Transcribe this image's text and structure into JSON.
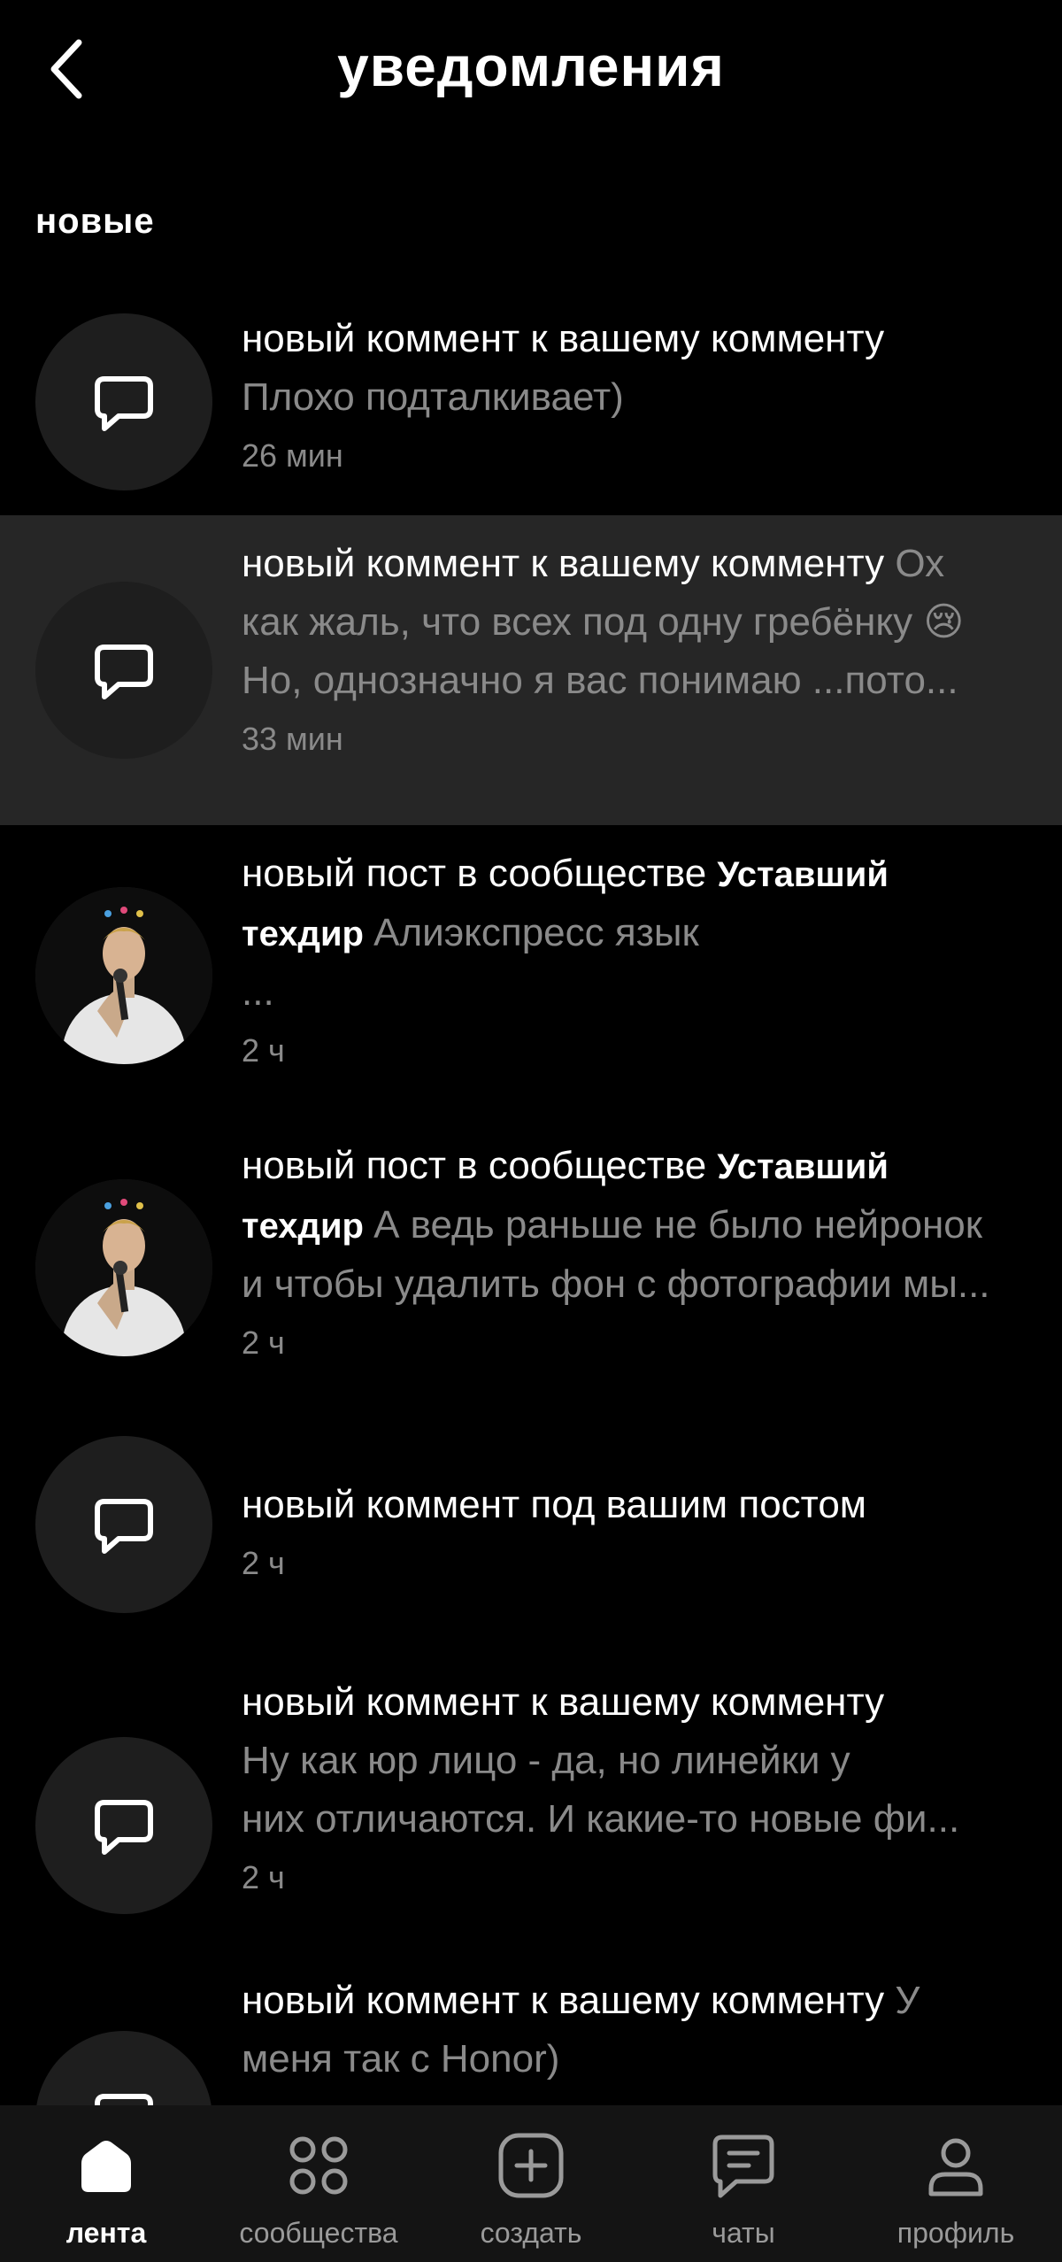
{
  "header": {
    "title": "уведомления"
  },
  "section": {
    "label": "новые"
  },
  "notifications": [
    {
      "lines": [
        [
          {
            "t": "новый коммент к вашему комменту",
            "c": "w"
          }
        ],
        [
          {
            "t": "Плохо подталкивает)",
            "c": "g"
          }
        ]
      ],
      "time": "26 мин",
      "icon": "comment-icon"
    },
    {
      "lines": [
        [
          {
            "t": "новый коммент к вашему комменту ",
            "c": "w"
          },
          {
            "t": "Ох",
            "c": "g"
          }
        ],
        [
          {
            "t": "как жаль, что всех под одну гребёнку 😢",
            "c": "g"
          }
        ],
        [
          {
            "t": "Но,  однозначно я вас понимаю ...пото...",
            "c": "g"
          }
        ]
      ],
      "time": "33 мин",
      "icon": "comment-icon"
    },
    {
      "lines": [
        [
          {
            "t": "новый пост в сообществе ",
            "c": "w"
          },
          {
            "t": "Уставший",
            "c": "b"
          }
        ],
        [
          {
            "t": "техдир ",
            "c": "b"
          },
          {
            "t": "Алиэкспресс язык",
            "c": "g"
          }
        ],
        [
          {
            "t": "...",
            "c": "g"
          }
        ]
      ],
      "time": "2 ч",
      "icon": "community-avatar"
    },
    {
      "lines": [
        [
          {
            "t": "новый пост в сообществе ",
            "c": "w"
          },
          {
            "t": "Уставший",
            "c": "b"
          }
        ],
        [
          {
            "t": "техдир ",
            "c": "b"
          },
          {
            "t": "А ведь раньше не было нейронок",
            "c": "g"
          }
        ],
        [
          {
            "t": "и чтобы удалить фон с фотографии мы...",
            "c": "g"
          }
        ]
      ],
      "time": "2 ч",
      "icon": "community-avatar"
    },
    {
      "lines": [
        [
          {
            "t": "новый коммент под вашим постом",
            "c": "w"
          }
        ]
      ],
      "time": "2 ч",
      "icon": "comment-icon"
    },
    {
      "lines": [
        [
          {
            "t": "новый коммент к вашему комменту",
            "c": "w"
          }
        ],
        [
          {
            "t": "Ну как юр лицо - да, но линейки у",
            "c": "g"
          }
        ],
        [
          {
            "t": "них отличаются. И какие-то новые фи...",
            "c": "g"
          }
        ]
      ],
      "time": "2 ч",
      "icon": "comment-icon"
    },
    {
      "lines": [
        [
          {
            "t": "новый коммент к вашему комменту ",
            "c": "w"
          },
          {
            "t": "У",
            "c": "g"
          }
        ],
        [
          {
            "t": "меня так с Honor)",
            "c": "g"
          }
        ]
      ],
      "time": "",
      "icon": "comment-icon"
    }
  ],
  "tabs": [
    {
      "label": "лента",
      "icon": "home-icon",
      "active": true
    },
    {
      "label": "сообщества",
      "icon": "grid-icon",
      "active": false
    },
    {
      "label": "создать",
      "icon": "plus-square-icon",
      "active": false
    },
    {
      "label": "чаты",
      "icon": "chat-icon",
      "active": false
    },
    {
      "label": "профиль",
      "icon": "profile-icon",
      "active": false
    }
  ]
}
